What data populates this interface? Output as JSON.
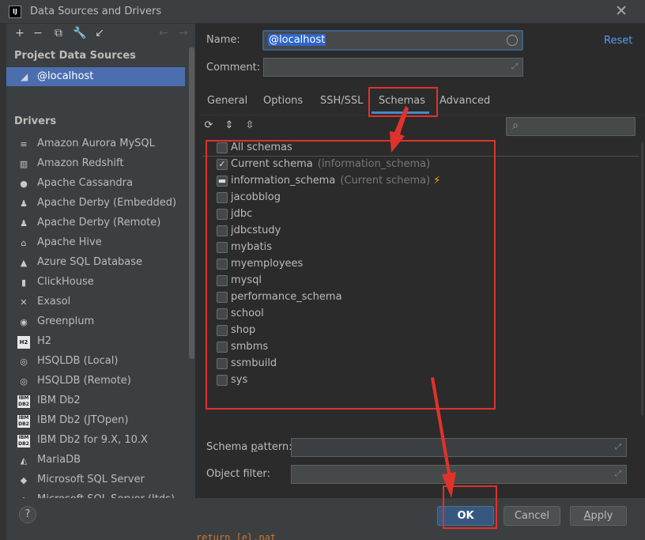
{
  "window": {
    "title": "Data Sources and Drivers",
    "app_icon": "IJ",
    "close_icon": "close-icon"
  },
  "left_panel": {
    "project_heading": "Project Data Sources",
    "selected_source": "@localhost",
    "drivers_heading": "Drivers",
    "drivers": [
      {
        "label": "Amazon Aurora MySQL",
        "icon": "aurora-icon"
      },
      {
        "label": "Amazon Redshift",
        "icon": "redshift-icon"
      },
      {
        "label": "Apache Cassandra",
        "icon": "cassandra-icon"
      },
      {
        "label": "Apache Derby (Embedded)",
        "icon": "derby-icon"
      },
      {
        "label": "Apache Derby (Remote)",
        "icon": "derby-icon"
      },
      {
        "label": "Apache Hive",
        "icon": "hive-icon"
      },
      {
        "label": "Azure SQL Database",
        "icon": "azure-icon"
      },
      {
        "label": "ClickHouse",
        "icon": "clickhouse-icon"
      },
      {
        "label": "Exasol",
        "icon": "exasol-icon"
      },
      {
        "label": "Greenplum",
        "icon": "greenplum-icon"
      },
      {
        "label": "H2",
        "icon": "h2-icon"
      },
      {
        "label": "HSQLDB (Local)",
        "icon": "hsqldb-icon"
      },
      {
        "label": "HSQLDB (Remote)",
        "icon": "hsqldb-icon"
      },
      {
        "label": "IBM Db2",
        "icon": "ibm-db2-icon"
      },
      {
        "label": "IBM Db2 (JTOpen)",
        "icon": "ibm-db2-icon"
      },
      {
        "label": "IBM Db2 for 9.X, 10.X",
        "icon": "ibm-db2-icon"
      },
      {
        "label": "MariaDB",
        "icon": "mariadb-icon"
      },
      {
        "label": "Microsoft SQL Server",
        "icon": "mssql-icon"
      },
      {
        "label": "Microsoft SQL Server (Jtds)",
        "icon": "mssql-icon"
      }
    ]
  },
  "form": {
    "name_label": "Name:",
    "name_value": "@localhost",
    "reset": "Reset",
    "comment_label": "Comment:",
    "comment_value": ""
  },
  "tabs": [
    "General",
    "Options",
    "SSH/SSL",
    "Schemas",
    "Advanced"
  ],
  "active_tab": "Schemas",
  "schemas": [
    {
      "label": "All schemas",
      "hint": "",
      "state": "unchecked"
    },
    {
      "label": "Current schema",
      "hint": "(information_schema)",
      "state": "checked"
    },
    {
      "label": "information_schema",
      "hint": "(Current schema)",
      "state": "partial"
    },
    {
      "label": "jacobblog",
      "hint": "",
      "state": "unchecked"
    },
    {
      "label": "jdbc",
      "hint": "",
      "state": "unchecked"
    },
    {
      "label": "jdbcstudy",
      "hint": "",
      "state": "unchecked"
    },
    {
      "label": "mybatis",
      "hint": "",
      "state": "unchecked"
    },
    {
      "label": "myemployees",
      "hint": "",
      "state": "unchecked"
    },
    {
      "label": "mysql",
      "hint": "",
      "state": "unchecked"
    },
    {
      "label": "performance_schema",
      "hint": "",
      "state": "unchecked"
    },
    {
      "label": "school",
      "hint": "",
      "state": "unchecked"
    },
    {
      "label": "shop",
      "hint": "",
      "state": "unchecked"
    },
    {
      "label": "smbms",
      "hint": "",
      "state": "unchecked"
    },
    {
      "label": "ssmbuild",
      "hint": "",
      "state": "unchecked"
    },
    {
      "label": "sys",
      "hint": "",
      "state": "unchecked"
    }
  ],
  "schema_pattern": {
    "label_pre": "Schema ",
    "label_mn": "p",
    "label_post": "attern:",
    "value": ""
  },
  "object_filter": {
    "label": "Object filter:",
    "value": ""
  },
  "buttons": {
    "help": "?",
    "ok": "OK",
    "cancel": "Cancel",
    "apply_mn": "A",
    "apply_rest": "pply"
  },
  "background_code": "return [el.nat"
}
